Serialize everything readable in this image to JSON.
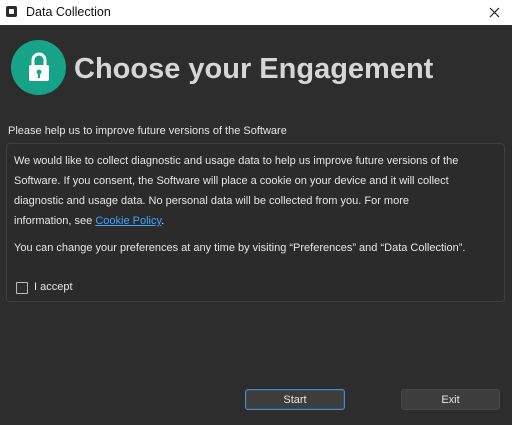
{
  "window": {
    "title": "Data Collection"
  },
  "header": {
    "heading": "Choose your Engagement",
    "icon": "lock-icon",
    "accent_color": "#16a387"
  },
  "content": {
    "subtitle": "Please help us to improve future versions of the Software",
    "paragraph1_lines": [
      "We would like to collect diagnostic and usage data to help us improve future versions of the",
      "Software. If you consent, the Software will place a cookie on your device and it will collect",
      "diagnostic and usage data. No personal data will be collected from you. For more"
    ],
    "paragraph1_last_prefix": "information, see ",
    "cookie_policy_link": "Cookie Policy",
    "paragraph1_last_suffix": ".",
    "paragraph2": "You can change your preferences at any time by visiting “Preferences” and “Data Collection”.",
    "accept_label": "I accept",
    "accept_checked": false,
    "link_color": "#3fa2ff"
  },
  "buttons": {
    "start": "Start",
    "exit": "Exit"
  }
}
